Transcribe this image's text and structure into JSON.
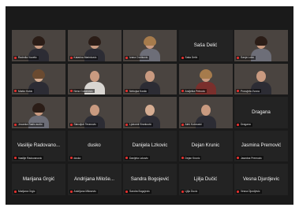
{
  "app": {
    "theme": {
      "window_bg": "#1a1a1a",
      "tile_bg": "#232323",
      "name_color": "#f2f2f2",
      "muted_mic_color": "#e0302e"
    }
  },
  "participants": [
    {
      "tile_name": "",
      "label": "Radmila Vucetic"
    },
    {
      "tile_name": "",
      "label": "Katarina Marinkovic"
    },
    {
      "tile_name": "",
      "label": "Ivana Cvetkovic"
    },
    {
      "tile_name": "Saša Delić",
      "label": "Saša Delić"
    },
    {
      "tile_name": "",
      "label": "Sanja Lukic"
    },
    {
      "tile_name": "",
      "label": "Marko Kukic"
    },
    {
      "tile_name": "",
      "label": "Neno Cukanovic"
    },
    {
      "tile_name": "",
      "label": "Nebojsa Kostic"
    },
    {
      "tile_name": "",
      "label": "Andjelka Petrovic"
    },
    {
      "tile_name": "",
      "label": "Prosvjeta Zvona"
    },
    {
      "tile_name": "",
      "label": "Jovanka Radic audio"
    },
    {
      "tile_name": "",
      "label": "Slavoljub Teranovic"
    },
    {
      "tile_name": "",
      "label": "Ljubomir Brankovic"
    },
    {
      "tile_name": "",
      "label": "Aleš Kulovacić"
    },
    {
      "tile_name": "Dragana",
      "label": "Dragana"
    },
    {
      "tile_name": "Vasilije Radovano...",
      "label": "Vasilije Radovanovic"
    },
    {
      "tile_name": "dusko",
      "label": "dusko"
    },
    {
      "tile_name": "Danijela Lzkovic",
      "label": "Danijela Lzkovic"
    },
    {
      "tile_name": "Dejan Krunic",
      "label": "Dejan Krunic"
    },
    {
      "tile_name": "Jasmina Premović",
      "label": "Jasmina Premovic"
    },
    {
      "tile_name": "Marijana Grgić",
      "label": "Marijana Grgic"
    },
    {
      "tile_name": "Andrijana Miloše...",
      "label": "Andrijana Milosevic"
    },
    {
      "tile_name": "Sandra Bogojević",
      "label": "Sandra Bogojevic"
    },
    {
      "tile_name": "Ljilja Dučić",
      "label": "Ljilja Ducic"
    },
    {
      "tile_name": "Vesna Djurdjevic",
      "label": "Vesna Djurdjevic"
    }
  ]
}
